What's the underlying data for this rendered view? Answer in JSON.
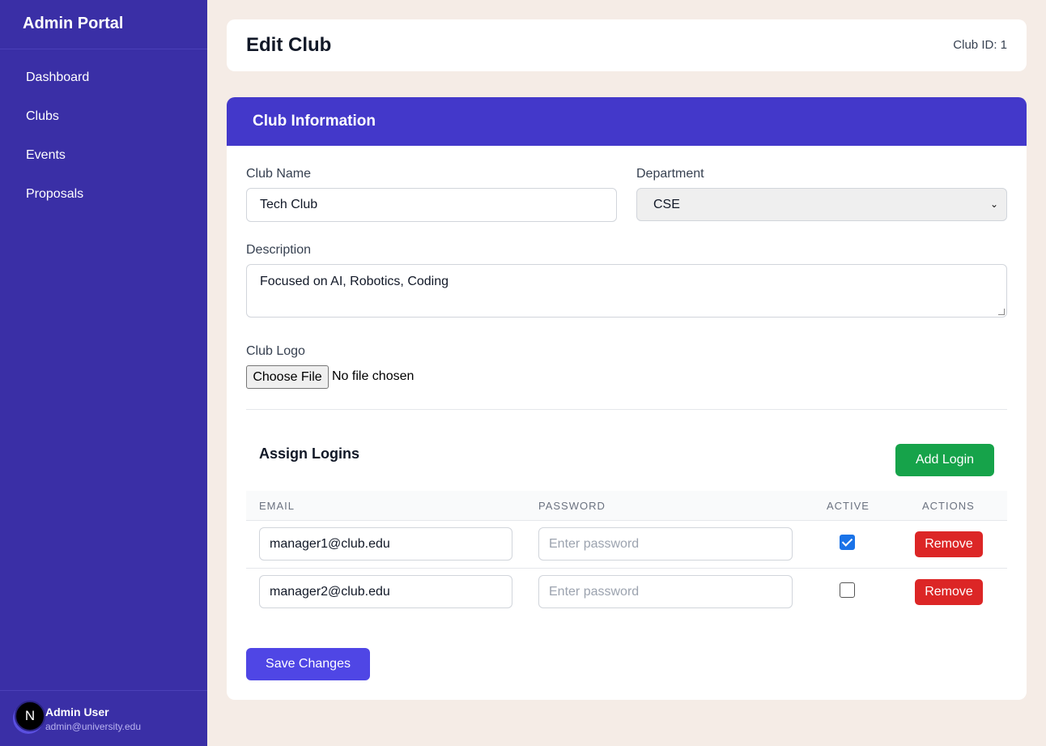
{
  "sidebar": {
    "brand": "Admin Portal",
    "items": [
      {
        "label": "Dashboard"
      },
      {
        "label": "Clubs"
      },
      {
        "label": "Events"
      },
      {
        "label": "Proposals"
      }
    ],
    "user": {
      "initial": "N",
      "name": "Admin User",
      "email": "admin@university.edu"
    }
  },
  "header": {
    "title": "Edit Club",
    "club_id": "Club ID: 1"
  },
  "form": {
    "section_title": "Club Information",
    "club_name": {
      "label": "Club Name",
      "value": "Tech Club"
    },
    "department": {
      "label": "Department",
      "value": "CSE"
    },
    "description": {
      "label": "Description",
      "value": "Focused on AI, Robotics, Coding"
    },
    "logo": {
      "label": "Club Logo",
      "button": "Choose File",
      "status": "No file chosen"
    },
    "logins": {
      "title": "Assign Logins",
      "add_label": "Add Login",
      "columns": [
        "EMAIL",
        "PASSWORD",
        "ACTIVE",
        "ACTIONS"
      ],
      "rows": [
        {
          "email": "manager1@club.edu",
          "password_placeholder": "Enter password",
          "active": true,
          "remove_label": "Remove"
        },
        {
          "email": "manager2@club.edu",
          "password_placeholder": "Enter password",
          "active": false,
          "remove_label": "Remove"
        }
      ]
    },
    "save_label": "Save Changes"
  },
  "colors": {
    "sidebar": "#3a2fa6",
    "card_header": "#4338ca",
    "add": "#16a34a",
    "remove": "#dc2626",
    "save": "#4f46e5"
  }
}
